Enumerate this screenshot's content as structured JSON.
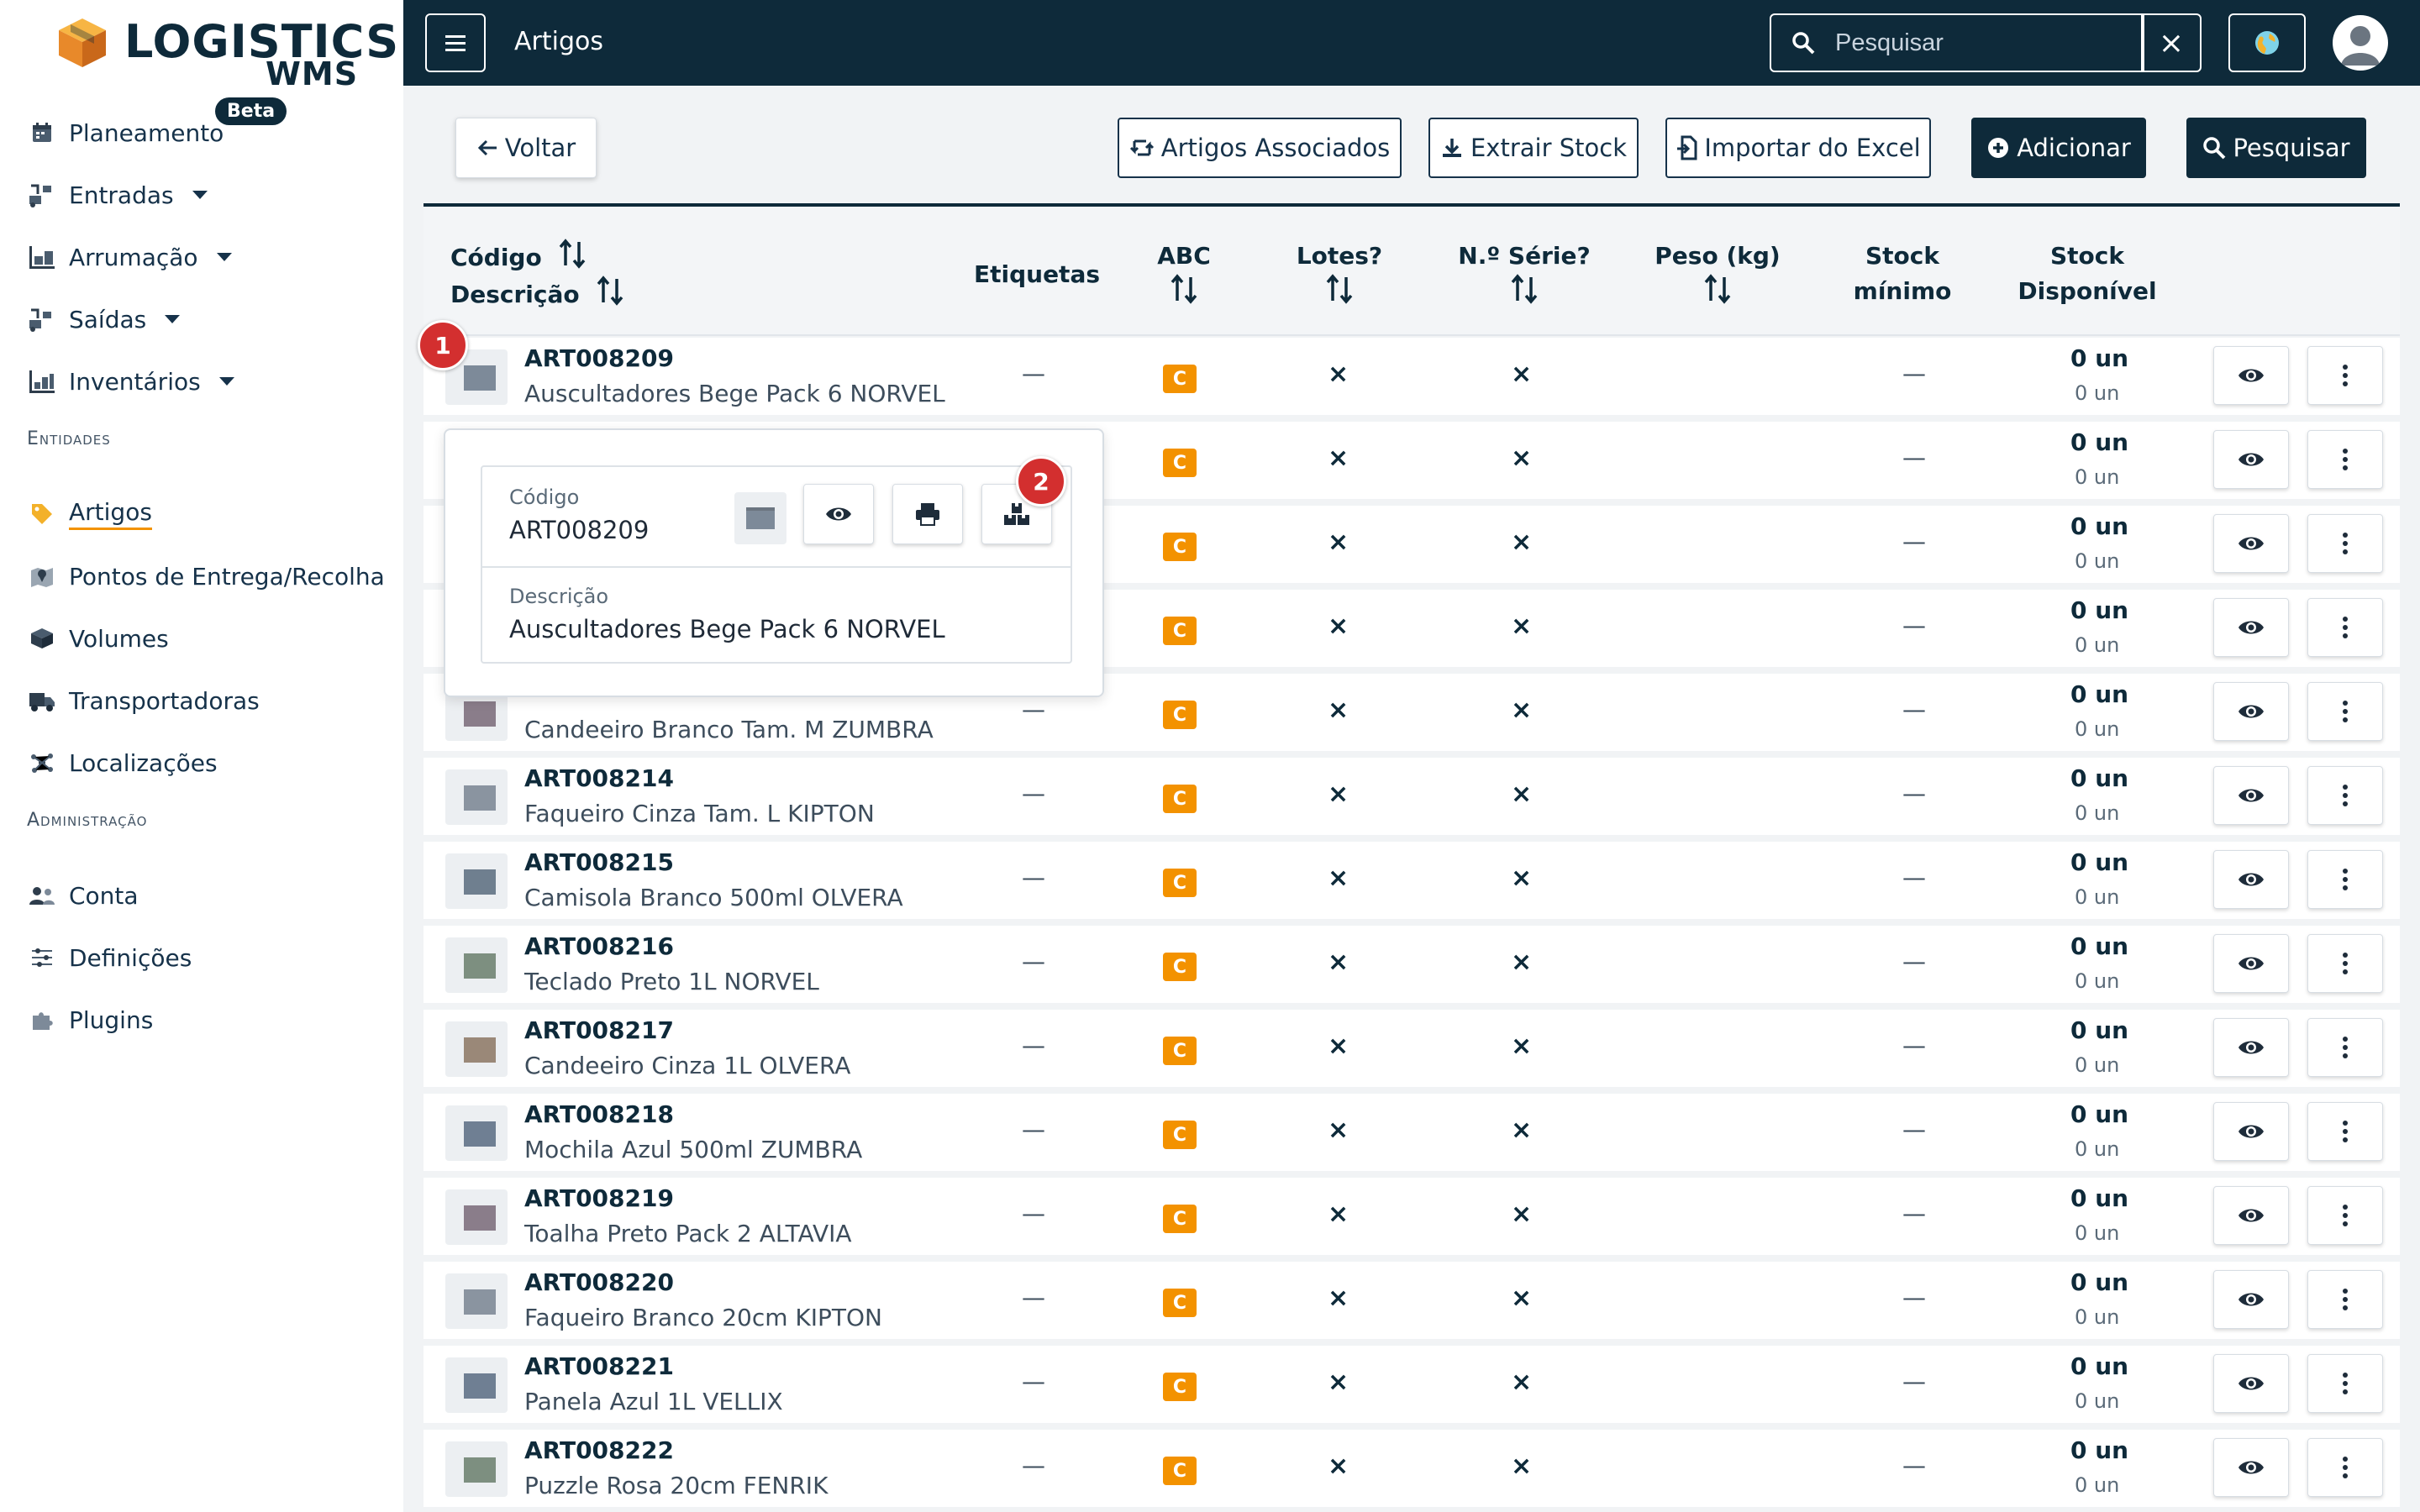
{
  "app": {
    "brand_line1": "LOGISTICS",
    "brand_line2": "WMS"
  },
  "sidebar": {
    "items": [
      {
        "label": "Planeamento",
        "badge": "Beta",
        "icon": "calendar-icon"
      },
      {
        "label": "Entradas",
        "icon": "inbound-icon",
        "expandable": true
      },
      {
        "label": "Arrumação",
        "icon": "shelving-icon",
        "expandable": true
      },
      {
        "label": "Saídas",
        "icon": "outbound-icon",
        "expandable": true
      },
      {
        "label": "Inventários",
        "icon": "inventory-icon",
        "expandable": true
      }
    ],
    "section_entidades": "Entidades",
    "entidades": [
      {
        "label": "Artigos",
        "icon": "tag-icon",
        "active": true
      },
      {
        "label": "Pontos de Entrega/Recolha",
        "icon": "map-pin-icon"
      },
      {
        "label": "Volumes",
        "icon": "box-icon"
      },
      {
        "label": "Transportadoras",
        "icon": "truck-icon"
      },
      {
        "label": "Localizações",
        "icon": "network-icon"
      }
    ],
    "section_admin": "Administração",
    "admin": [
      {
        "label": "Conta",
        "icon": "users-icon"
      },
      {
        "label": "Definições",
        "icon": "sliders-icon"
      },
      {
        "label": "Plugins",
        "icon": "puzzle-icon"
      }
    ]
  },
  "topbar": {
    "title": "Artigos",
    "search_placeholder": "Pesquisar",
    "clear": "×"
  },
  "toolbar": {
    "back": "Voltar",
    "associated": "Artigos Associados",
    "extract": "Extrair Stock",
    "import": "Importar do Excel",
    "add": "Adicionar",
    "search": "Pesquisar"
  },
  "table": {
    "headers": {
      "code": "Código",
      "description": "Descrição",
      "labels": "Etiquetas",
      "abc": "ABC",
      "lots": "Lotes?",
      "serial": "N.º Série?",
      "weight": "Peso (kg)",
      "min_stock_1": "Stock",
      "min_stock_2": "mínimo",
      "avail_stock_1": "Stock",
      "avail_stock_2": "Disponível"
    },
    "rows": [
      {
        "code": "ART008209",
        "description": "Auscultadores Bege Pack 6 NORVEL",
        "labels": "—",
        "abc": "C",
        "lots": "×",
        "serial": "×",
        "min": "—",
        "stock": "0 un",
        "stock_sub": "0 un",
        "thumb": "#7d8a99"
      },
      {
        "code": "",
        "description": "",
        "labels": "—",
        "abc": "C",
        "lots": "×",
        "serial": "×",
        "min": "—",
        "stock": "0 un",
        "stock_sub": "0 un",
        "thumb": "#7d8a99"
      },
      {
        "code": "",
        "description": "",
        "labels": "—",
        "abc": "C",
        "lots": "×",
        "serial": "×",
        "min": "—",
        "stock": "0 un",
        "stock_sub": "0 un",
        "thumb": "#7d8a99"
      },
      {
        "code": "",
        "description": "",
        "labels": "—",
        "abc": "C",
        "lots": "×",
        "serial": "×",
        "min": "—",
        "stock": "0 un",
        "stock_sub": "0 un",
        "thumb": "#7d8a99"
      },
      {
        "code": "",
        "description": "Candeeiro Branco Tam. M ZUMBRA",
        "labels": "—",
        "abc": "C",
        "lots": "×",
        "serial": "×",
        "min": "—",
        "stock": "0 un",
        "stock_sub": "0 un",
        "thumb": "#8a7d8a"
      },
      {
        "code": "ART008214",
        "description": "Faqueiro Cinza Tam. L KIPTON",
        "labels": "—",
        "abc": "C",
        "lots": "×",
        "serial": "×",
        "min": "—",
        "stock": "0 un",
        "stock_sub": "0 un",
        "thumb": "#8a94a0"
      },
      {
        "code": "ART008215",
        "description": "Camisola Branco 500ml OLVERA",
        "labels": "—",
        "abc": "C",
        "lots": "×",
        "serial": "×",
        "min": "—",
        "stock": "0 un",
        "stock_sub": "0 un",
        "thumb": "#6f7f8f"
      },
      {
        "code": "ART008216",
        "description": "Teclado Preto 1L NORVEL",
        "labels": "—",
        "abc": "C",
        "lots": "×",
        "serial": "×",
        "min": "—",
        "stock": "0 un",
        "stock_sub": "0 un",
        "thumb": "#7d8f80"
      },
      {
        "code": "ART008217",
        "description": "Candeeiro Cinza 1L OLVERA",
        "labels": "—",
        "abc": "C",
        "lots": "×",
        "serial": "×",
        "min": "—",
        "stock": "0 un",
        "stock_sub": "0 un",
        "thumb": "#9a8878"
      },
      {
        "code": "ART008218",
        "description": "Mochila Azul 500ml ZUMBRA",
        "labels": "—",
        "abc": "C",
        "lots": "×",
        "serial": "×",
        "min": "—",
        "stock": "0 un",
        "stock_sub": "0 un",
        "thumb": "#6f7f93"
      },
      {
        "code": "ART008219",
        "description": "Toalha Preto Pack 2 ALTAVIA",
        "labels": "—",
        "abc": "C",
        "lots": "×",
        "serial": "×",
        "min": "—",
        "stock": "0 un",
        "stock_sub": "0 un",
        "thumb": "#8a7d8a"
      },
      {
        "code": "ART008220",
        "description": "Faqueiro Branco 20cm KIPTON",
        "labels": "—",
        "abc": "C",
        "lots": "×",
        "serial": "×",
        "min": "—",
        "stock": "0 un",
        "stock_sub": "0 un",
        "thumb": "#8a94a0"
      },
      {
        "code": "ART008221",
        "description": "Panela Azul 1L VELLIX",
        "labels": "—",
        "abc": "C",
        "lots": "×",
        "serial": "×",
        "min": "—",
        "stock": "0 un",
        "stock_sub": "0 un",
        "thumb": "#6f7f93"
      },
      {
        "code": "ART008222",
        "description": "Puzzle Rosa 20cm FENRIK",
        "labels": "—",
        "abc": "C",
        "lots": "×",
        "serial": "×",
        "min": "—",
        "stock": "0 un",
        "stock_sub": "0 un",
        "thumb": "#7d8f80"
      }
    ]
  },
  "popover": {
    "code_label": "Código",
    "code_value": "ART008209",
    "desc_label": "Descrição",
    "desc_value": "Auscultadores Bege Pack 6 NORVEL"
  },
  "markers": {
    "one": "1",
    "two": "2"
  },
  "colors": {
    "primary": "#0e2a3a",
    "accent": "#f39200",
    "marker": "#d32f2f"
  }
}
